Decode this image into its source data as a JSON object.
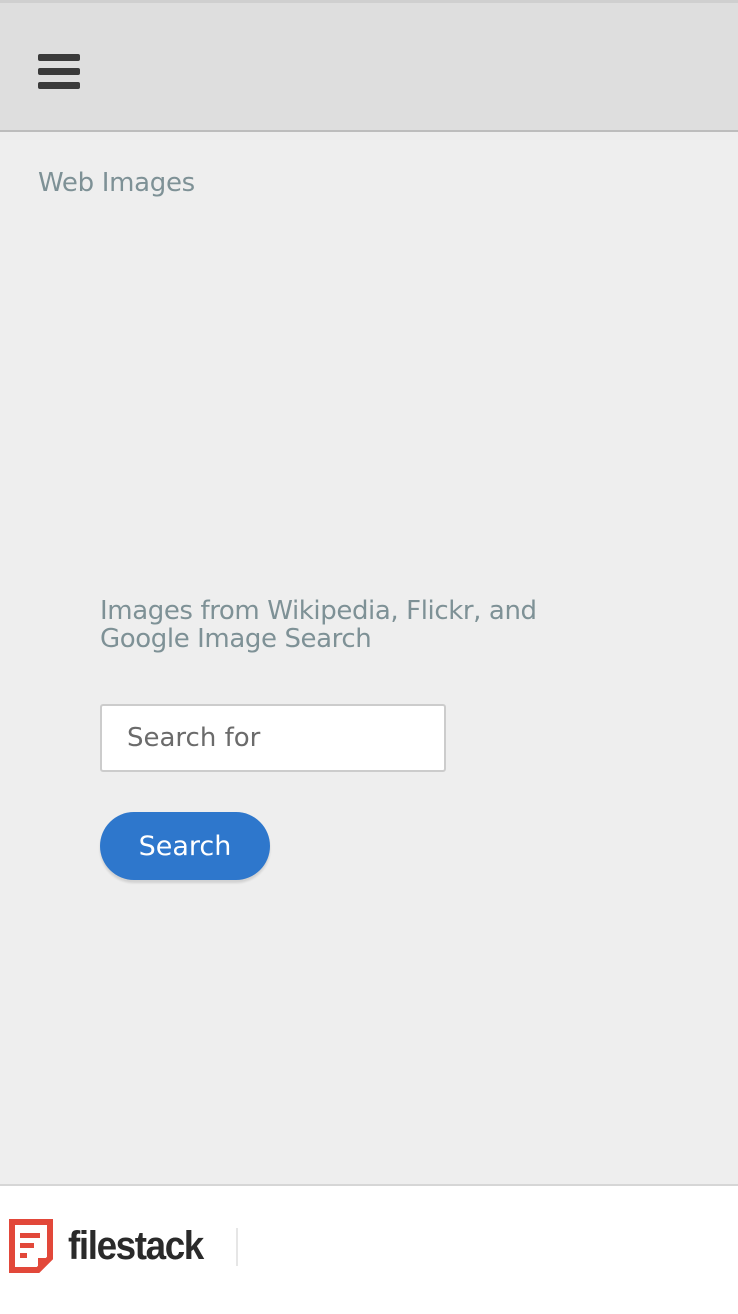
{
  "header": {
    "menu_icon": "hamburger-menu-icon"
  },
  "main": {
    "title": "Web Images",
    "description": "Images from Wikipedia, Flickr, and Google Image Search",
    "search": {
      "placeholder": "Search for",
      "value": ""
    },
    "search_button_label": "Search"
  },
  "footer": {
    "logo_text": "filestack",
    "logo_icon": "filestack-logo-icon",
    "brand_color": "#e2483a"
  },
  "colors": {
    "accent": "#2e77cc",
    "muted_text": "#7e9196",
    "header_bg": "#dedede",
    "page_bg": "#eeeeee"
  }
}
